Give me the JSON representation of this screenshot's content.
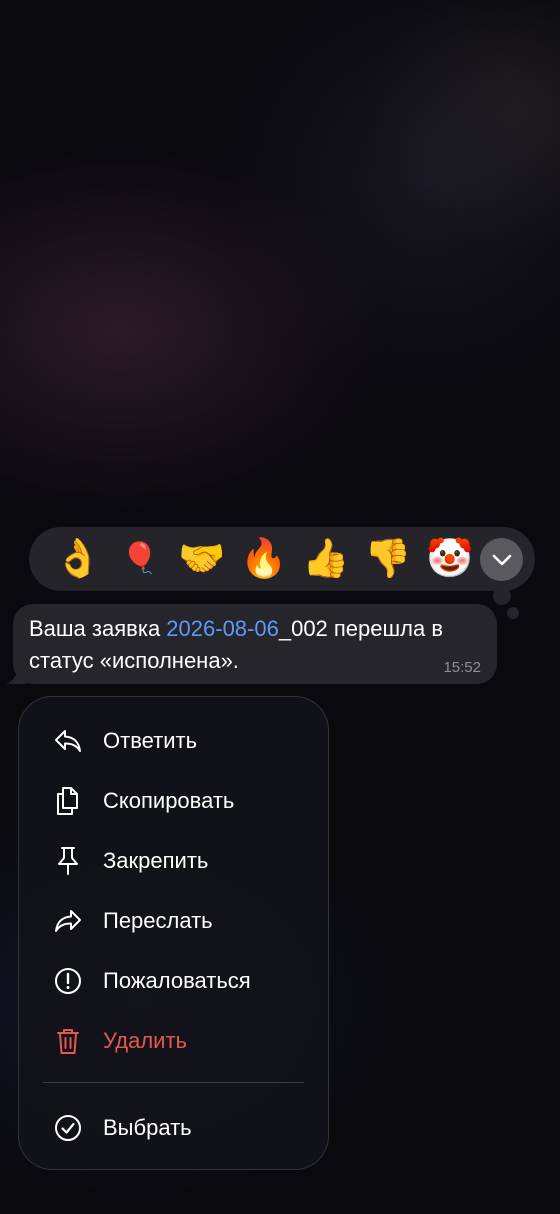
{
  "reactions": [
    {
      "emoji": "👌",
      "name": "ok-hand"
    },
    {
      "emoji": "🎈",
      "name": "red-balloon"
    },
    {
      "emoji": "🤝",
      "name": "handshake"
    },
    {
      "emoji": "🔥",
      "name": "fire"
    },
    {
      "emoji": "👍",
      "name": "thumbs-up"
    },
    {
      "emoji": "👎",
      "name": "thumbs-down"
    },
    {
      "emoji": "🤡",
      "name": "clown-face"
    }
  ],
  "message": {
    "text_before": "Ваша заявка ",
    "link_text": "2026-08-06",
    "text_after": "_002 перешла в статус «исполнена».",
    "time": "15:52",
    "link_color": "#5a9cf5"
  },
  "menu": {
    "reply": "Ответить",
    "copy": "Скопировать",
    "pin": "Закрепить",
    "forward": "Переслать",
    "report": "Пожаловаться",
    "delete": "Удалить",
    "select": "Выбрать"
  },
  "colors": {
    "danger": "#e8584a",
    "bubble": "#26252c",
    "menu_bg": "#12121a"
  }
}
